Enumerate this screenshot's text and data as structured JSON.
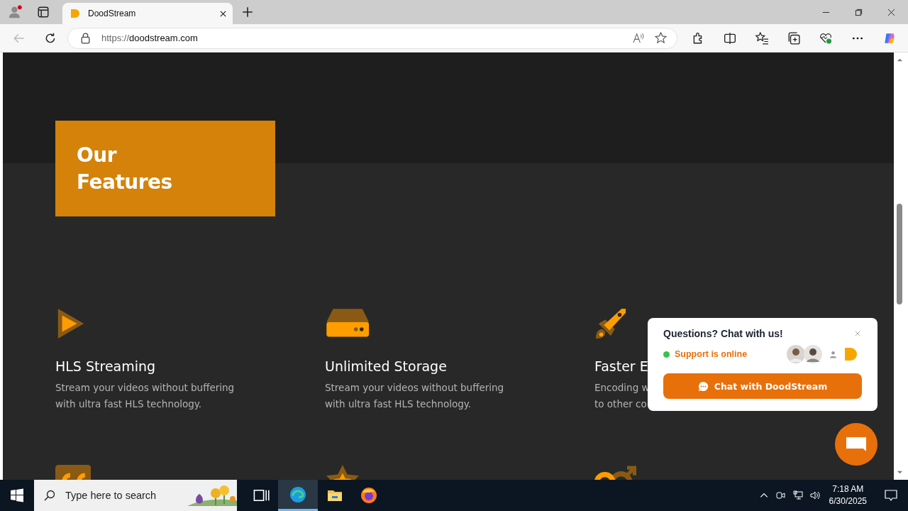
{
  "browser": {
    "tabs": [
      {
        "title": "DoodStream",
        "selected": true
      }
    ],
    "url_scheme": "https://",
    "url_host": "doodstream.com"
  },
  "page": {
    "heading_lines": [
      "Our",
      "Features"
    ],
    "features": [
      {
        "title": "HLS Streaming",
        "lines": [
          "Stream your videos without buffering",
          "with ultra fast HLS technology."
        ]
      },
      {
        "title": "Unlimited Storage",
        "lines": [
          "Stream your videos without buffering",
          "with ultra fast HLS technology."
        ]
      },
      {
        "title": "Faster E",
        "lines": [
          "Encoding w",
          "to other co"
        ]
      }
    ]
  },
  "chat_popup": {
    "title": "Questions? Chat with us!",
    "status": "Support is online",
    "online": true,
    "button": "Chat with DoodStream"
  },
  "taskbar": {
    "search_placeholder": "Type here to search",
    "time": "7:18 AM",
    "date": "6/30/2025"
  }
}
